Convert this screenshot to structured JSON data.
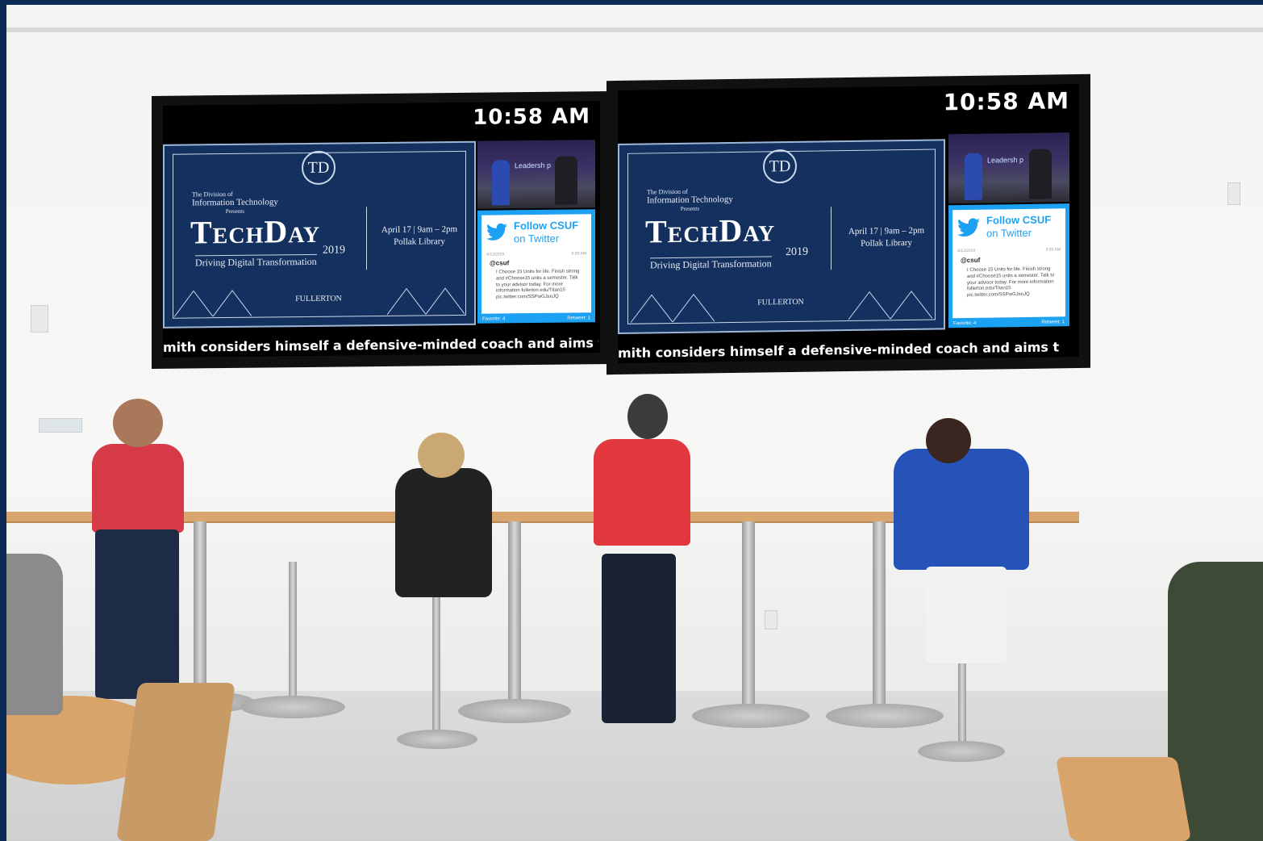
{
  "screens": [
    {
      "clock": "10:58 AM",
      "presents_line1": "The Division of",
      "presents_line2": "Information Technology",
      "presents_line3": "Presents",
      "title": "TechDay",
      "year": "2019",
      "tagline": "Driving Digital Transformation",
      "date_line1": "April 17 | 9am – 2pm",
      "date_line2": "Pollak Library",
      "logo_letters": "TD",
      "fullerton": "FULLERTON",
      "video_banner": "Leadersh p",
      "twitter_heading1": "Follow CSUF",
      "twitter_heading2": "on Twitter",
      "tweet_date": "4/12/2019",
      "tweet_time": "9:00 AM",
      "tweet_handle": "@csuf",
      "tweet_body": "I Choose 15 Units for life. Finish strong and #Choose15 units a semester. Talk to your advisor today. For more information fullerton.edu/Titan15 pic.twitter.com/SSPwGJsnJQ",
      "favorites": "Favorite: 4",
      "retweets": "Retweet: 1",
      "ticker": "mith considers himself a defensive-minded coach and aims t"
    },
    {
      "clock": "10:58 AM",
      "presents_line1": "The Division of",
      "presents_line2": "Information Technology",
      "presents_line3": "Presents",
      "title": "TechDay",
      "year": "2019",
      "tagline": "Driving Digital Transformation",
      "date_line1": "April 17 | 9am – 2pm",
      "date_line2": "Pollak Library",
      "logo_letters": "TD",
      "fullerton": "FULLERTON",
      "video_banner": "Leadersh p",
      "twitter_heading1": "Follow CSUF",
      "twitter_heading2": "on Twitter",
      "tweet_date": "4/12/2019",
      "tweet_time": "9:00 AM",
      "tweet_handle": "@csuf",
      "tweet_body": "I Choose 15 Units for life. Finish strong and #Choose15 units a semester. Talk to your advisor today. For more information fullerton.edu/Titan15 pic.twitter.com/SSPwGJsnJQ",
      "favorites": "Favorite: 4",
      "retweets": "Retweet: 1",
      "ticker": "mith considers himself a defensive-minded coach and aims t"
    }
  ],
  "colors": {
    "slide_navy": "#13305e",
    "twitter_blue": "#1da1f2",
    "frame_blue": "#0b2a55"
  }
}
